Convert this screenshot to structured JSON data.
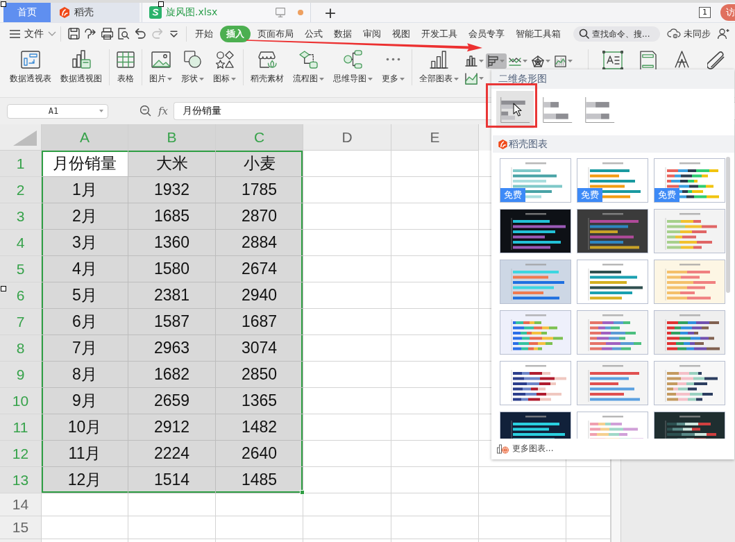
{
  "title_bar": {
    "tabs": [
      {
        "kind": "home",
        "label": "首页",
        "selected": false
      },
      {
        "kind": "docer",
        "label": "稻壳",
        "selected": false
      },
      {
        "kind": "sheet",
        "label": "旋风图.xlsx",
        "selected": true,
        "unsaved": true
      }
    ],
    "new_tab": "+",
    "page_count": "1",
    "visitor": "访"
  },
  "menu_bar": {
    "file": "文件",
    "quick_access": [
      {
        "disabled": false
      },
      {
        "disabled": false
      },
      {
        "disabled": false
      },
      {
        "disabled": false
      },
      {
        "disabled": false
      },
      {
        "disabled": true
      },
      {
        "disabled": false
      }
    ],
    "tabs": [
      {
        "label": "开始",
        "selected": false
      },
      {
        "label": "插入",
        "selected": true
      },
      {
        "label": "页面布局",
        "selected": false
      },
      {
        "label": "公式",
        "selected": false
      },
      {
        "label": "数据",
        "selected": false
      },
      {
        "label": "审阅",
        "selected": false
      },
      {
        "label": "视图",
        "selected": false
      },
      {
        "label": "开发工具",
        "selected": false
      },
      {
        "label": "会员专享",
        "selected": false
      },
      {
        "label": "智能工具箱",
        "selected": false
      }
    ],
    "search": {
      "placeholder": "查找命令、搜..."
    },
    "sync": "未同步"
  },
  "ribbon": {
    "groups": [
      {
        "items": [
          {
            "label": "数据透视表",
            "dropdown": false
          },
          {
            "label": "数据透视图",
            "dropdown": false
          }
        ]
      },
      {
        "items": [
          {
            "label": "表格",
            "dropdown": false
          }
        ]
      },
      {
        "items": [
          {
            "label": "图片",
            "dropdown": true
          },
          {
            "label": "形状",
            "dropdown": true
          },
          {
            "label": "图标",
            "dropdown": true
          }
        ]
      },
      {
        "items": [
          {
            "label": "稻壳素材",
            "dropdown": false
          },
          {
            "label": "流程图",
            "dropdown": true
          },
          {
            "label": "思维导图",
            "dropdown": true
          },
          {
            "label": "更多",
            "dropdown": true
          }
        ]
      },
      {
        "items": [
          {
            "label": "全部图表",
            "dropdown": true
          }
        ]
      }
    ],
    "chart_buttons": [
      {
        "pressed": false
      },
      {
        "pressed": true
      },
      {
        "pressed": false
      },
      {
        "pressed": false
      },
      {
        "pressed": false
      },
      {
        "pressed": false
      }
    ]
  },
  "formula_bar": {
    "name_box": "A1",
    "fx": "fx",
    "value": "月份销量"
  },
  "sheet": {
    "columns": [
      {
        "label": "A",
        "selected": true
      },
      {
        "label": "B",
        "selected": true
      },
      {
        "label": "C",
        "selected": true
      },
      {
        "label": "D",
        "selected": false
      },
      {
        "label": "E",
        "selected": false
      }
    ],
    "rows": [
      {
        "label": "1",
        "selected": true,
        "cells": [
          {
            "text": "月份销量",
            "active": true
          },
          {
            "text": "大米",
            "active": false
          },
          {
            "text": "小麦",
            "active": false
          }
        ]
      },
      {
        "label": "2",
        "selected": true,
        "cells": [
          {
            "text": "1月",
            "active": false
          },
          {
            "text": "1932",
            "active": false
          },
          {
            "text": "1785",
            "active": false
          }
        ]
      },
      {
        "label": "3",
        "selected": true,
        "cells": [
          {
            "text": "2月",
            "active": false
          },
          {
            "text": "1685",
            "active": false
          },
          {
            "text": "2870",
            "active": false
          }
        ]
      },
      {
        "label": "4",
        "selected": true,
        "cells": [
          {
            "text": "3月",
            "active": false
          },
          {
            "text": "1360",
            "active": false
          },
          {
            "text": "2884",
            "active": false
          }
        ]
      },
      {
        "label": "5",
        "selected": true,
        "cells": [
          {
            "text": "4月",
            "active": false
          },
          {
            "text": "1580",
            "active": false
          },
          {
            "text": "2674",
            "active": false
          }
        ]
      },
      {
        "label": "6",
        "selected": true,
        "cells": [
          {
            "text": "5月",
            "active": false
          },
          {
            "text": "2381",
            "active": false
          },
          {
            "text": "2940",
            "active": false
          }
        ]
      },
      {
        "label": "7",
        "selected": true,
        "cells": [
          {
            "text": "6月",
            "active": false
          },
          {
            "text": "1587",
            "active": false
          },
          {
            "text": "1687",
            "active": false
          }
        ]
      },
      {
        "label": "8",
        "selected": true,
        "cells": [
          {
            "text": "7月",
            "active": false
          },
          {
            "text": "2963",
            "active": false
          },
          {
            "text": "3074",
            "active": false
          }
        ]
      },
      {
        "label": "9",
        "selected": true,
        "cells": [
          {
            "text": "8月",
            "active": false
          },
          {
            "text": "1682",
            "active": false
          },
          {
            "text": "2850",
            "active": false
          }
        ]
      },
      {
        "label": "10",
        "selected": true,
        "cells": [
          {
            "text": "9月",
            "active": false
          },
          {
            "text": "2659",
            "active": false
          },
          {
            "text": "1365",
            "active": false
          }
        ]
      },
      {
        "label": "11",
        "selected": true,
        "cells": [
          {
            "text": "10月",
            "active": false
          },
          {
            "text": "2912",
            "active": false
          },
          {
            "text": "1482",
            "active": false
          }
        ]
      },
      {
        "label": "12",
        "selected": true,
        "cells": [
          {
            "text": "11月",
            "active": false
          },
          {
            "text": "2224",
            "active": false
          },
          {
            "text": "2640",
            "active": false
          }
        ]
      },
      {
        "label": "13",
        "selected": true,
        "cells": [
          {
            "text": "12月",
            "active": false
          },
          {
            "text": "1514",
            "active": false
          },
          {
            "text": "1485",
            "active": false
          }
        ]
      },
      {
        "label": "14",
        "selected": false
      },
      {
        "label": "15",
        "selected": false
      }
    ]
  },
  "chart_menu": {
    "title": "二维条形图",
    "chart_types": [
      {
        "kind": "clustered",
        "selected": true
      },
      {
        "kind": "stacked",
        "selected": false
      },
      {
        "kind": "percent_stacked",
        "selected": false
      }
    ],
    "docer_title": "稻壳图表",
    "templates": [
      {
        "color": "#ffffff",
        "badge": "免费"
      },
      {
        "color": "#ffffff",
        "badge": "免费"
      },
      {
        "color": "#ffffff",
        "badge": "免费"
      },
      {
        "color": "#0e1116"
      },
      {
        "color": "#3b3b3b"
      },
      {
        "color": "#f3f3f3"
      },
      {
        "color": "#cdd7e5"
      },
      {
        "color": "#ffffff"
      },
      {
        "color": "#fdf6e4"
      },
      {
        "color": "#eef0fb"
      },
      {
        "color": "#f6f6f6"
      },
      {
        "color": "#efefef"
      },
      {
        "color": "#ffffff"
      },
      {
        "color": "#f4f4f4"
      },
      {
        "color": "#f7f7f7"
      },
      {
        "color": "#11213a"
      },
      {
        "color": "#ffffff"
      },
      {
        "color": "#1f2e30"
      }
    ],
    "more": "更多图表..."
  }
}
